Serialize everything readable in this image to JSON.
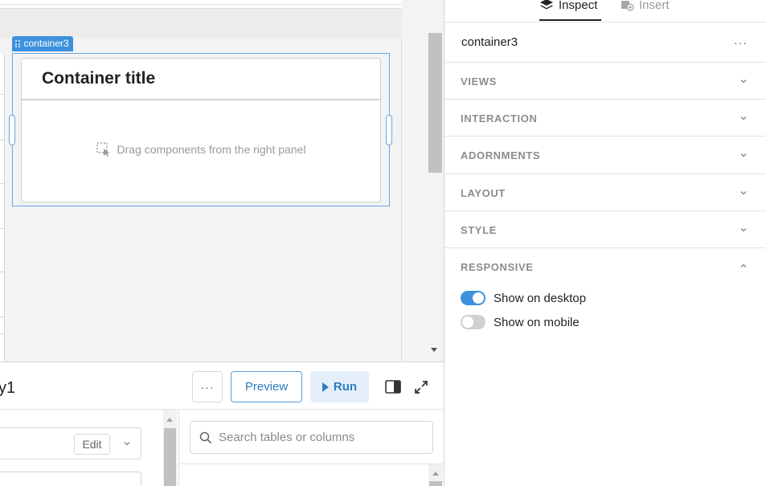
{
  "canvas": {
    "component_tag": "container3",
    "container_title": "Container title",
    "drop_hint": "Drag components from the right panel"
  },
  "query_panel": {
    "title_fragment": "y1",
    "more_label": "···",
    "preview_label": "Preview",
    "run_label": "Run",
    "edit_label": "Edit",
    "search_placeholder": "Search tables or columns"
  },
  "inspector": {
    "tabs": [
      {
        "label": "Inspect",
        "icon": "layers-icon",
        "active": true
      },
      {
        "label": "Insert",
        "icon": "insert-component-icon",
        "active": false
      }
    ],
    "component_name": "container3",
    "menu_label": "···",
    "sections": [
      {
        "label": "VIEWS",
        "expanded": false
      },
      {
        "label": "INTERACTION",
        "expanded": false
      },
      {
        "label": "ADORNMENTS",
        "expanded": false
      },
      {
        "label": "LAYOUT",
        "expanded": false
      },
      {
        "label": "STYLE",
        "expanded": false
      },
      {
        "label": "RESPONSIVE",
        "expanded": true
      }
    ],
    "responsive": {
      "desktop": {
        "label": "Show on desktop",
        "on": true
      },
      "mobile": {
        "label": "Show on mobile",
        "on": false
      }
    }
  },
  "colors": {
    "accent": "#3c92dc",
    "accent_text": "#2d7cc4",
    "run_bg": "#e4effa",
    "section_label": "#8c8c8c"
  }
}
